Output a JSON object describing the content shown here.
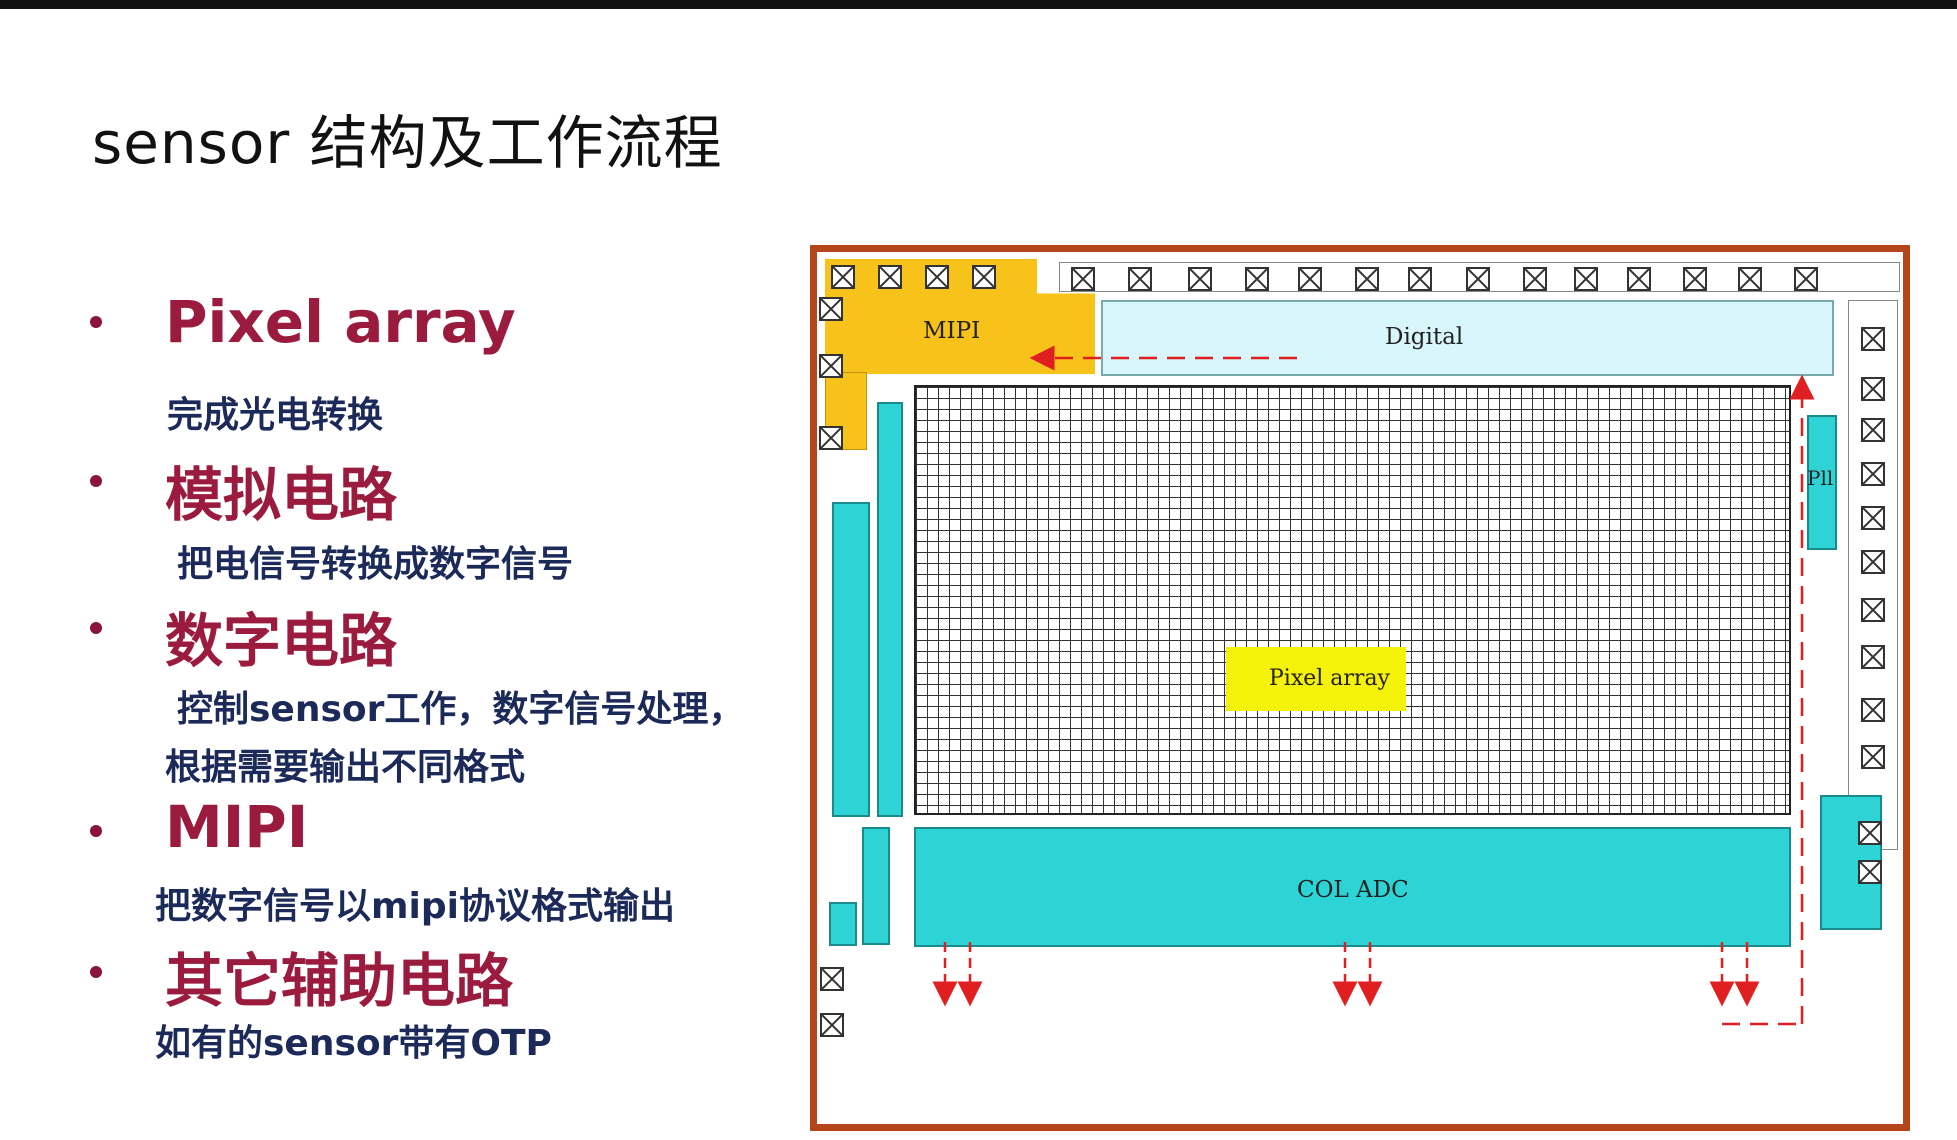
{
  "title": "sensor 结构及工作流程",
  "items": [
    {
      "heading": "Pixel array",
      "desc": [
        "完成光电转换"
      ]
    },
    {
      "heading": "模拟电路",
      "desc": [
        "把电信号转换成数字信号"
      ]
    },
    {
      "heading": "数字电路",
      "desc": [
        "控制sensor工作，数字信号处理，",
        "根据需要输出不同格式"
      ]
    },
    {
      "heading": "MIPI",
      "desc": [
        "把数字信号以mipi协议格式输出"
      ]
    },
    {
      "heading": "其它辅助电路",
      "desc": [
        "如有的sensor带有OTP"
      ]
    }
  ],
  "diagram": {
    "mipi": "MIPI",
    "digital": "Digital",
    "pixel_array": "Pixel array",
    "pll": "Pll",
    "col_adc": "COL ADC"
  },
  "colors": {
    "heading": "#9b1b3f",
    "desc": "#1c2a5a",
    "chip_border": "#b5451b",
    "mipi_block": "#f7c21a",
    "digital_block": "#d8f6fb",
    "analog_block": "#2ed3d6",
    "pixel_label": "#f5f20a",
    "arrow": "#e02020"
  }
}
